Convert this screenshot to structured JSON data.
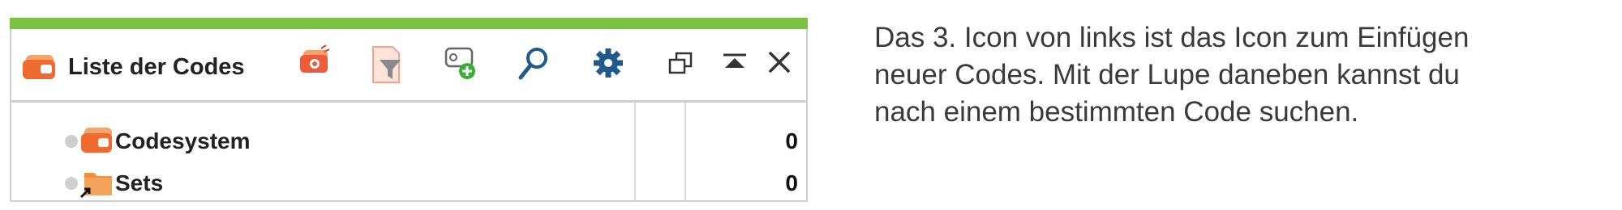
{
  "panel": {
    "title": "Liste der Codes",
    "toolbar": {
      "icons": [
        "code-set-icon",
        "filter-document-icon",
        "new-code-icon",
        "search-icon",
        "settings-gear-icon",
        "undock-window-icon",
        "collapse-up-icon",
        "close-icon"
      ]
    },
    "rows": [
      {
        "label": "Codesystem",
        "count": "0",
        "icon": "code-system-icon"
      },
      {
        "label": "Sets",
        "count": "0",
        "icon": "folder-shortcut-icon"
      }
    ]
  },
  "caption": {
    "lines": [
      "Das 3. Icon von links ist das Icon zum Einfügen",
      "neuer Codes. Mit der Lupe daneben kannst du",
      "nach einem bestimmten Code suchen."
    ]
  },
  "colors": {
    "accent_green": "#7bc142",
    "code_orange": "#f07a3a",
    "icon_blue": "#1f5a8a",
    "border_gray": "#cfcfcf"
  }
}
